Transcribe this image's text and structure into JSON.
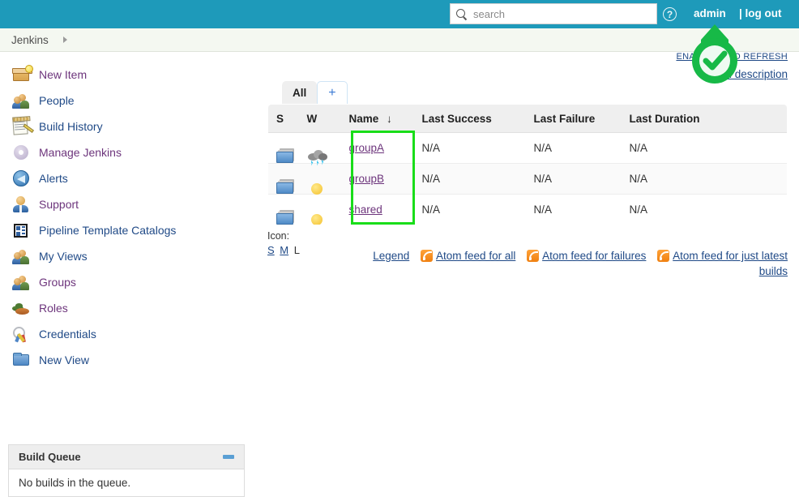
{
  "header": {
    "search_placeholder": "search",
    "search_value": "",
    "help_label": "?",
    "user": "admin",
    "logout": "| log out"
  },
  "breadcrumb": {
    "root": "Jenkins"
  },
  "sidebar": {
    "items": [
      {
        "label": "New Item",
        "icon": "new-item-icon",
        "visited": true
      },
      {
        "label": "People",
        "icon": "people-icon",
        "visited": false
      },
      {
        "label": "Build History",
        "icon": "build-history-icon",
        "visited": false
      },
      {
        "label": "Manage Jenkins",
        "icon": "gear-icon",
        "visited": true
      },
      {
        "label": "Alerts",
        "icon": "alerts-icon",
        "visited": false
      },
      {
        "label": "Support",
        "icon": "support-icon",
        "visited": true
      },
      {
        "label": "Pipeline Template Catalogs",
        "icon": "pipeline-catalog-icon",
        "visited": false
      },
      {
        "label": "My Views",
        "icon": "people-icon",
        "visited": false
      },
      {
        "label": "Groups",
        "icon": "groups-icon",
        "visited": true
      },
      {
        "label": "Roles",
        "icon": "roles-icon",
        "visited": true
      },
      {
        "label": "Credentials",
        "icon": "credentials-icon",
        "visited": false
      },
      {
        "label": "New View",
        "icon": "folder-icon",
        "visited": false
      }
    ],
    "build_queue": {
      "title": "Build Queue",
      "empty_text": "No builds in the queue."
    }
  },
  "main": {
    "auto_refresh_label": "ENABLE AUTO REFRESH",
    "add_description_label": "add description",
    "tabs": [
      {
        "label": "All",
        "active": true
      },
      {
        "label": "+",
        "active": false
      }
    ],
    "table": {
      "columns": [
        "S",
        "W",
        "Name",
        "Last Success",
        "Last Failure",
        "Last Duration"
      ],
      "sort_column": "Name",
      "sort_indicator": "↓",
      "rows": [
        {
          "status_icon": "folder-icon",
          "weather_icon": "storm-icon",
          "name": "groupA",
          "last_success": "N/A",
          "last_failure": "N/A",
          "last_duration": "N/A"
        },
        {
          "status_icon": "folder-icon",
          "weather_icon": "sunny-icon",
          "name": "groupB",
          "last_success": "N/A",
          "last_failure": "N/A",
          "last_duration": "N/A"
        },
        {
          "status_icon": "folder-icon",
          "weather_icon": "sunny-icon",
          "name": "shared",
          "last_success": "N/A",
          "last_failure": "N/A",
          "last_duration": "N/A"
        }
      ]
    },
    "footer": {
      "icon_label": "Icon:",
      "size_small": "S",
      "size_medium": "M",
      "size_large": "L",
      "legend": "Legend",
      "feed_all": "Atom feed for all",
      "feed_failures": "Atom feed for failures",
      "feed_latest": "Atom feed for just latest builds"
    }
  },
  "annotations": {
    "highlight_color": "#19dd19",
    "cursor_color": "#17b947",
    "highlight_target": "name-column-cells",
    "cursor_target": "add-description-link"
  }
}
